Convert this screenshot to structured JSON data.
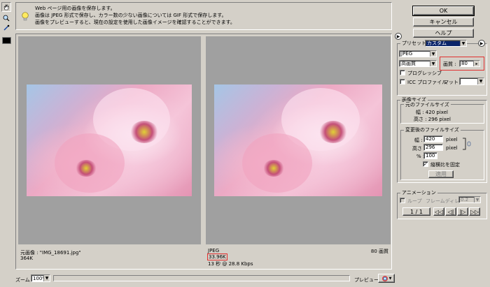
{
  "info": {
    "line1": "Web ページ用の画像を保存します。",
    "line2": "画像は JPEG 形式で保存し、カラー数の少ない画像については GIF 形式で保存します。",
    "line3": "画像をプレビューすると、現在の設定を使用した画像イメージを確認することができます。"
  },
  "buttons": {
    "ok": "OK",
    "cancel": "キャンセル",
    "help": "ヘルプ"
  },
  "preset": {
    "label": "プリセット :",
    "value": "カスタム"
  },
  "format": {
    "value": "JPEG"
  },
  "quality_level": {
    "value": "高画質"
  },
  "quality": {
    "label": "画質 :",
    "value": "80"
  },
  "progressive": {
    "label": "プログレッシブ",
    "checked": false
  },
  "icc": {
    "label": "ICC プロファイル",
    "checked": false
  },
  "matte": {
    "label": "マット :",
    "value": ""
  },
  "image_size": {
    "title": "画像サイズ",
    "original": {
      "title": "元のファイルサイズ",
      "width": "幅 : 420 pixel",
      "height": "高さ : 296 pixel"
    },
    "new": {
      "title": "変更後のファイルサイズ",
      "width_label": "幅 :",
      "width_value": "420",
      "height_label": "高さ :",
      "height_value": "296",
      "unit": "pixel",
      "percent_label": "% :",
      "percent_value": "100",
      "constrain_label": "縦横比を固定",
      "constrain_checked": true,
      "apply_label": "適用"
    }
  },
  "animation": {
    "title": "アニメーション",
    "loop_label": "ループ",
    "frame_delay_label": "フレームディレイ :",
    "frame_delay_value": "0.2",
    "frame_counter": "1 / 1"
  },
  "original_panel": {
    "name": "元画像 : \"IMG_18691.jpg\"",
    "size": "364K"
  },
  "optimized_panel": {
    "format": "JPEG",
    "size": "33.96K",
    "time": "13 秒 @ 28.8 Kbps",
    "quality": "80 画質"
  },
  "bottom": {
    "zoom_label": "ズーム :",
    "zoom_value": "100%",
    "preview_label": "プレビュー :"
  },
  "icons": {
    "hand": "hand-icon",
    "zoom": "magnifier-icon",
    "eyedropper": "eyedropper-icon",
    "color": "color-swatch-icon",
    "info": "lightbulb-icon",
    "arrow": "arrow-right-circle-icon",
    "browser": "browser-icon"
  },
  "colors": {
    "preset_highlight": "#0a246a",
    "quality_highlight_border": "#e03030",
    "size_highlight_border": "#e03030",
    "dialog_bg": "#d4d0c8",
    "preview_bg": "#a0a0a0"
  }
}
